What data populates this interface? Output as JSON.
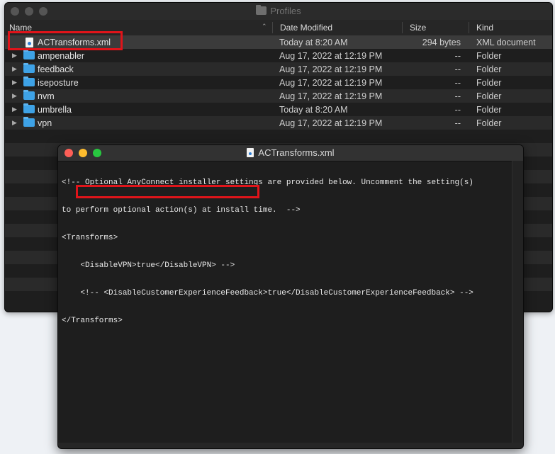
{
  "finder": {
    "title": "Profiles",
    "columns": {
      "name": "Name",
      "date": "Date Modified",
      "size": "Size",
      "kind": "Kind"
    },
    "rows": [
      {
        "name": "ACTransforms.xml",
        "date": "Today at 8:20 AM",
        "size": "294 bytes",
        "kind": "XML document",
        "icon": "xml-file-icon"
      },
      {
        "name": "ampenabler",
        "date": "Aug 17, 2022 at 12:19 PM",
        "size": "--",
        "kind": "Folder",
        "icon": "folder-icon"
      },
      {
        "name": "feedback",
        "date": "Aug 17, 2022 at 12:19 PM",
        "size": "--",
        "kind": "Folder",
        "icon": "folder-icon"
      },
      {
        "name": "iseposture",
        "date": "Aug 17, 2022 at 12:19 PM",
        "size": "--",
        "kind": "Folder",
        "icon": "folder-icon"
      },
      {
        "name": "nvm",
        "date": "Aug 17, 2022 at 12:19 PM",
        "size": "--",
        "kind": "Folder",
        "icon": "folder-icon"
      },
      {
        "name": "umbrella",
        "date": "Today at 8:20 AM",
        "size": "--",
        "kind": "Folder",
        "icon": "folder-icon"
      },
      {
        "name": "vpn",
        "date": "Aug 17, 2022 at 12:19 PM",
        "size": "--",
        "kind": "Folder",
        "icon": "folder-icon"
      }
    ]
  },
  "editor": {
    "title": "ACTransforms.xml",
    "lines": [
      "<!-- Optional AnyConnect installer settings are provided below. Uncomment the setting(s)",
      "to perform optional action(s) at install time.  -->",
      "<Transforms>",
      "    <DisableVPN>true</DisableVPN> -->",
      "    <!-- <DisableCustomerExperienceFeedback>true</DisableCustomerExperienceFeedback> -->",
      "</Transforms>"
    ]
  },
  "colors": {
    "highlight": "#e0141a",
    "folder": "#3ea2e6",
    "close": "#fe5f57",
    "minimize": "#febc2e",
    "zoom": "#28c840"
  }
}
